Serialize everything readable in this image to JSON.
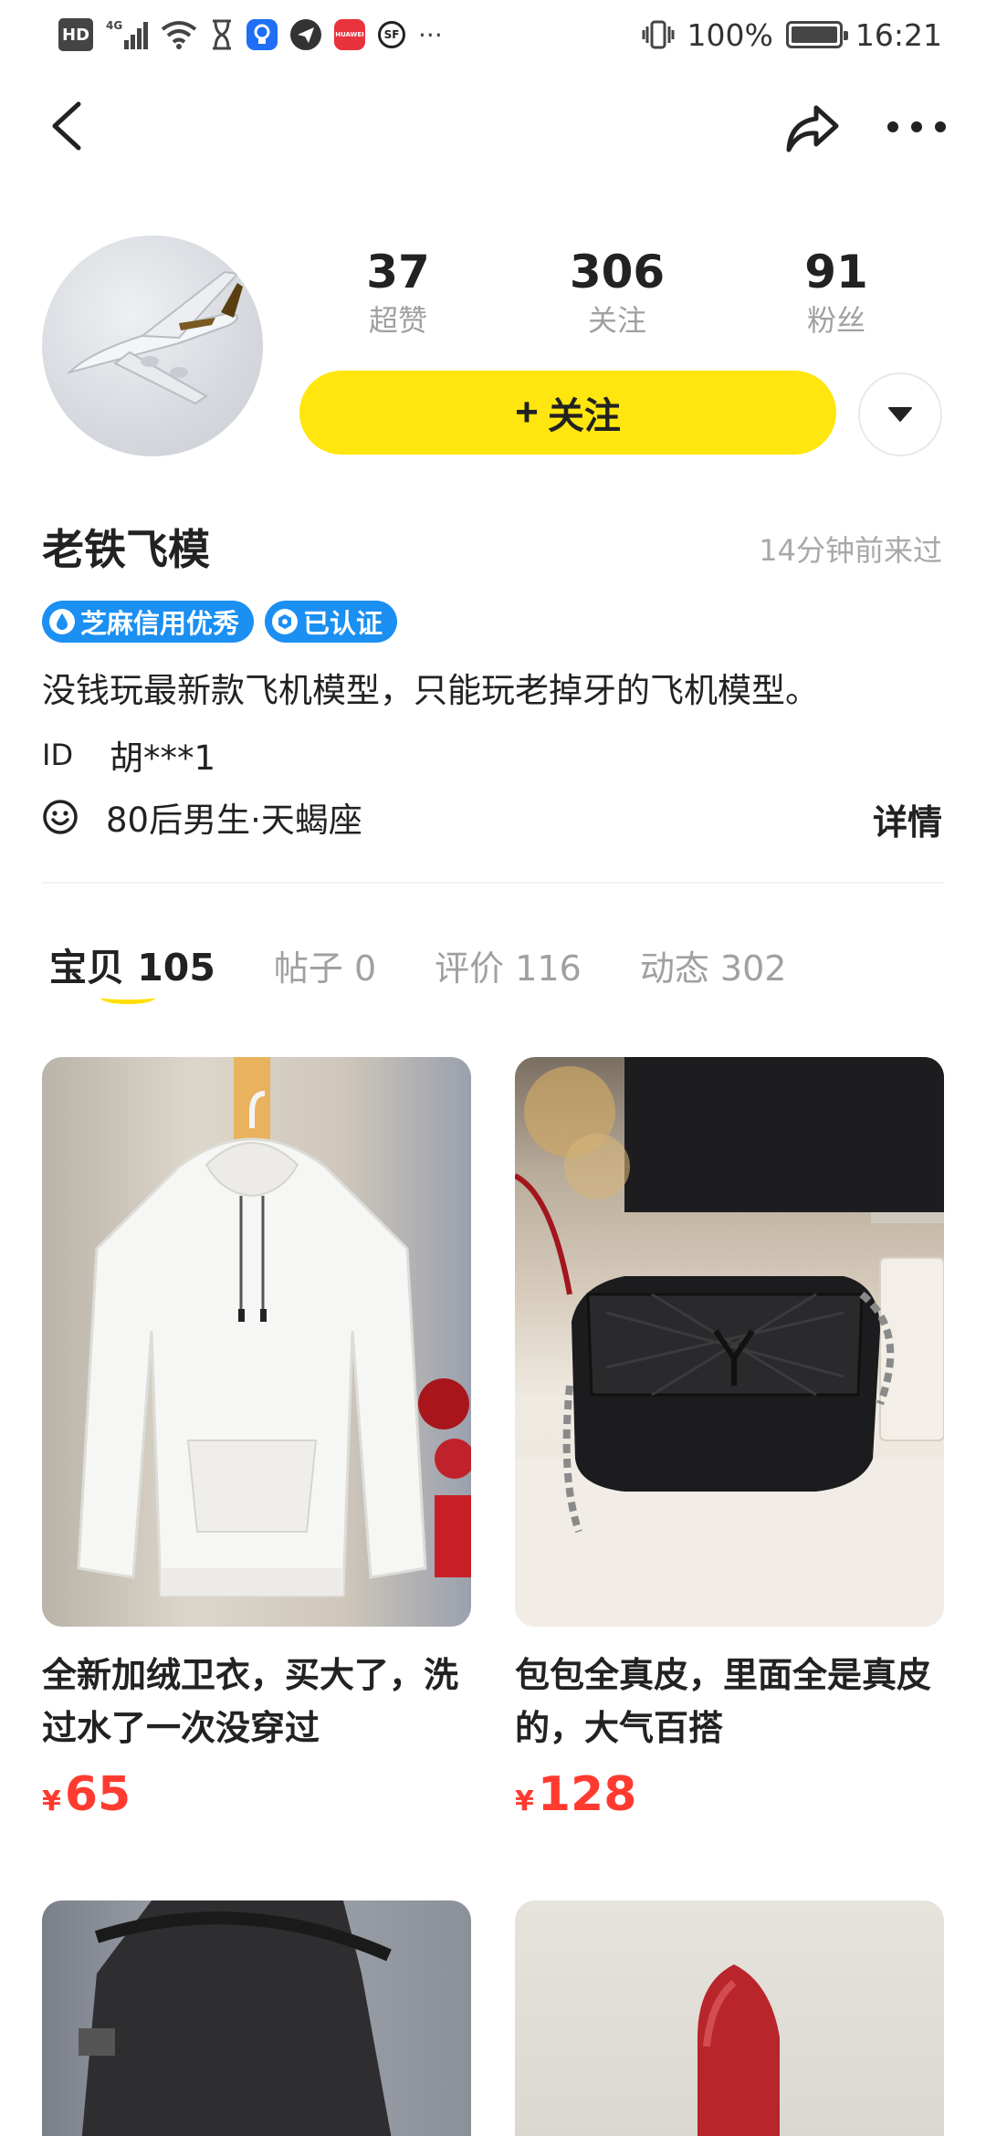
{
  "status_bar": {
    "hd": "HD",
    "network": "4G",
    "app1_label": "",
    "app2_label": "HUAWEI",
    "app3_label": "SF",
    "more": "···",
    "battery": "100%",
    "time": "16:21"
  },
  "nav": {
    "back_icon": "chevron-left-icon",
    "share_icon": "share-icon",
    "more_icon": "more-dots-icon"
  },
  "profile": {
    "stats": [
      {
        "value": "37",
        "label": "超赞"
      },
      {
        "value": "306",
        "label": "关注"
      },
      {
        "value": "91",
        "label": "粉丝"
      }
    ],
    "follow_label": "关注",
    "follow_plus": "+",
    "username": "老铁飞模",
    "last_seen": "14分钟前来过",
    "badges": [
      "芝麻信用优秀",
      "已认证"
    ],
    "bio": "没钱玩最新款飞机模型，只能玩老掉牙的飞机模型。",
    "id_label": "ID",
    "id_value": "胡***1",
    "info": "80后男生·天蝎座",
    "detail_label": "详情",
    "accent_color": "#ffe60f",
    "badge_color": "#1b8ff2"
  },
  "tabs": [
    {
      "name": "宝贝",
      "count": "105",
      "active": true
    },
    {
      "name": "帖子",
      "count": "0",
      "active": false
    },
    {
      "name": "评价",
      "count": "116",
      "active": false
    },
    {
      "name": "动态",
      "count": "302",
      "active": false
    }
  ],
  "items": [
    {
      "title": "全新加绒卫衣，买大了，洗过水了一次没穿过",
      "currency": "¥",
      "price": "65"
    },
    {
      "title": "包包全真皮，里面全是真皮的，大气百搭",
      "currency": "¥",
      "price": "128"
    },
    {
      "title": "",
      "currency": "",
      "price": ""
    },
    {
      "title": "",
      "currency": "",
      "price": ""
    }
  ],
  "price_color": "#ff3b30"
}
